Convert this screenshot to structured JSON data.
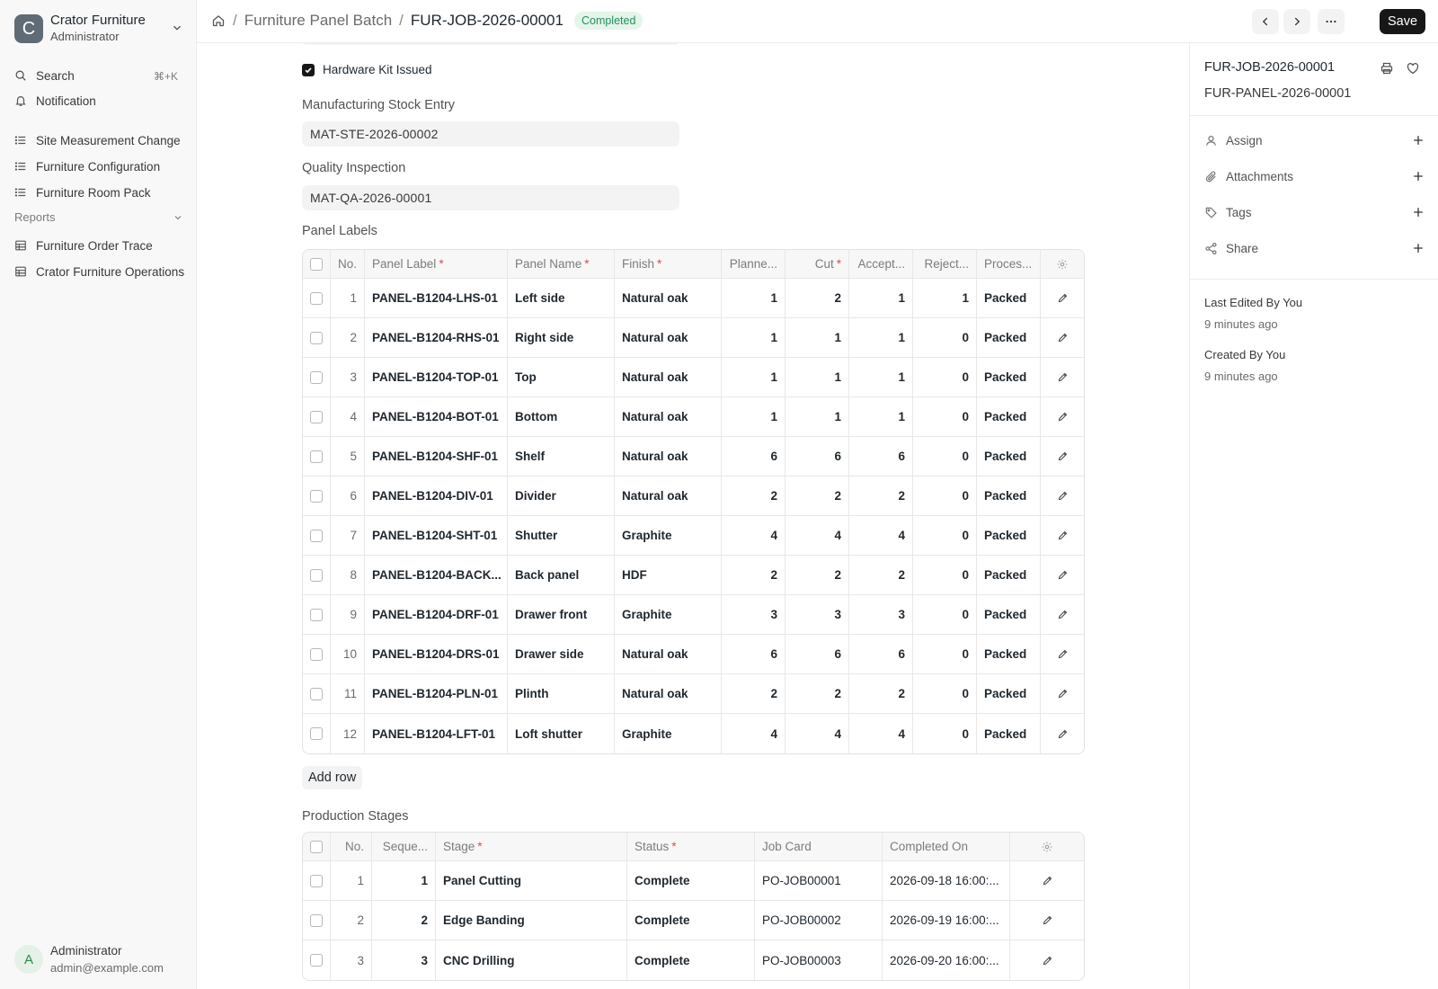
{
  "sidebar": {
    "brand": {
      "initial": "C",
      "name": "Crator Furniture",
      "role": "Administrator"
    },
    "search_label": "Search",
    "search_shortcut": "⌘+K",
    "notification_label": "Notification",
    "items": [
      {
        "label": "Site Measurement Change",
        "icon": "list-icon"
      },
      {
        "label": "Furniture Configuration",
        "icon": "list-icon"
      },
      {
        "label": "Furniture Room Pack",
        "icon": "list-icon"
      }
    ],
    "reports_label": "Reports",
    "reports": [
      {
        "label": "Furniture Order Trace",
        "icon": "table-icon"
      },
      {
        "label": "Crator Furniture Operations",
        "icon": "table-icon"
      }
    ],
    "user": {
      "initial": "A",
      "name": "Administrator",
      "email": "admin@example.com"
    }
  },
  "header": {
    "crumbs": [
      "Furniture Panel Batch",
      "FUR-JOB-2026-00001"
    ],
    "status": "Completed",
    "save_label": "Save"
  },
  "form": {
    "hardware_kit_label": "Hardware Kit Issued",
    "hardware_kit_checked": true,
    "stock_entry_label": "Manufacturing Stock Entry",
    "stock_entry_value": "MAT-STE-2026-00002",
    "quality_label": "Quality Inspection",
    "quality_value": "MAT-QA-2026-00001",
    "panel_labels_title": "Panel Labels",
    "panel_columns": [
      "No.",
      "Panel Label",
      "Panel Name",
      "Finish",
      "Planne...",
      "Cut",
      "Accept...",
      "Reject...",
      "Proces..."
    ],
    "panel_rows": [
      [
        "1",
        "PANEL-B1204-LHS-01",
        "Left side",
        "Natural oak",
        "1",
        "2",
        "1",
        "1",
        "Packed"
      ],
      [
        "2",
        "PANEL-B1204-RHS-01",
        "Right side",
        "Natural oak",
        "1",
        "1",
        "1",
        "0",
        "Packed"
      ],
      [
        "3",
        "PANEL-B1204-TOP-01",
        "Top",
        "Natural oak",
        "1",
        "1",
        "1",
        "0",
        "Packed"
      ],
      [
        "4",
        "PANEL-B1204-BOT-01",
        "Bottom",
        "Natural oak",
        "1",
        "1",
        "1",
        "0",
        "Packed"
      ],
      [
        "5",
        "PANEL-B1204-SHF-01",
        "Shelf",
        "Natural oak",
        "6",
        "6",
        "6",
        "0",
        "Packed"
      ],
      [
        "6",
        "PANEL-B1204-DIV-01",
        "Divider",
        "Natural oak",
        "2",
        "2",
        "2",
        "0",
        "Packed"
      ],
      [
        "7",
        "PANEL-B1204-SHT-01",
        "Shutter",
        "Graphite",
        "4",
        "4",
        "4",
        "0",
        "Packed"
      ],
      [
        "8",
        "PANEL-B1204-BACK...",
        "Back panel",
        "HDF",
        "2",
        "2",
        "2",
        "0",
        "Packed"
      ],
      [
        "9",
        "PANEL-B1204-DRF-01",
        "Drawer front",
        "Graphite",
        "3",
        "3",
        "3",
        "0",
        "Packed"
      ],
      [
        "10",
        "PANEL-B1204-DRS-01",
        "Drawer side",
        "Natural oak",
        "6",
        "6",
        "6",
        "0",
        "Packed"
      ],
      [
        "11",
        "PANEL-B1204-PLN-01",
        "Plinth",
        "Natural oak",
        "2",
        "2",
        "2",
        "0",
        "Packed"
      ],
      [
        "12",
        "PANEL-B1204-LFT-01",
        "Loft shutter",
        "Graphite",
        "4",
        "4",
        "4",
        "0",
        "Packed"
      ]
    ],
    "add_row_label": "Add row",
    "stages_title": "Production Stages",
    "stage_columns": [
      "No.",
      "Seque...",
      "Stage",
      "Status",
      "Job Card",
      "Completed On"
    ],
    "stage_rows": [
      [
        "1",
        "1",
        "Panel Cutting",
        "Complete",
        "PO-JOB00001",
        "2026-09-18 16:00:..."
      ],
      [
        "2",
        "2",
        "Edge Banding",
        "Complete",
        "PO-JOB00002",
        "2026-09-19 16:00:..."
      ],
      [
        "3",
        "3",
        "CNC Drilling",
        "Complete",
        "PO-JOB00003",
        "2026-09-20 16:00:..."
      ]
    ]
  },
  "right_panel": {
    "title": "FUR-JOB-2026-00001",
    "subtitle": "FUR-PANEL-2026-00001",
    "assign_label": "Assign",
    "attachments_label": "Attachments",
    "tags_label": "Tags",
    "share_label": "Share",
    "last_edited": "Last Edited By You",
    "last_edited_time": "9 minutes ago",
    "created": "Created By You",
    "created_time": "9 minutes ago"
  },
  "colors": {
    "accent": "#171717",
    "status_bg": "#e4f5e9",
    "status_text": "#278f5e",
    "required": "#e24c4c"
  }
}
